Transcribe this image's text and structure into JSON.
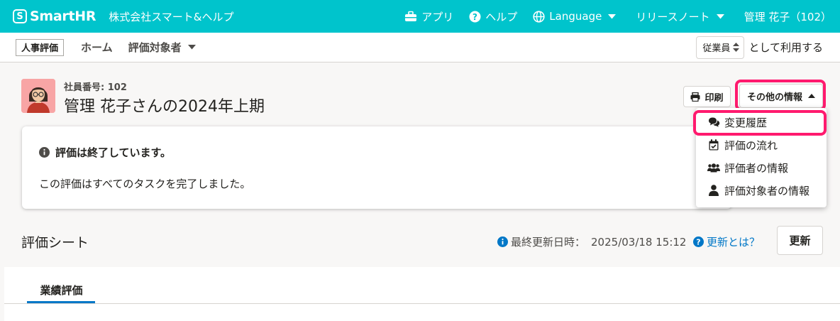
{
  "header": {
    "logo_mark": "S",
    "logo_text": "SmartHR",
    "tenant": "株式会社スマート&ヘルプ",
    "nav": {
      "apps": "アプリ",
      "help": "ヘルプ",
      "language": "Language",
      "release_notes": "リリースノート",
      "user": "管理 花子（102）"
    }
  },
  "subheader": {
    "app_label": "人事評価",
    "home": "ホーム",
    "targets": "評価対象者",
    "role_value": "従業員",
    "role_suffix": "として利用する"
  },
  "profile": {
    "employee_number": "社員番号: 102",
    "title": "管理 花子さんの2024年上期"
  },
  "actions": {
    "print": "印刷",
    "more_info": "その他の情報"
  },
  "dropdown": {
    "items": [
      {
        "label": "変更履歴",
        "icon": "comments-icon"
      },
      {
        "label": "評価の流れ",
        "icon": "calendar-check-icon"
      },
      {
        "label": "評価者の情報",
        "icon": "users-icon"
      },
      {
        "label": "評価対象者の情報",
        "icon": "user-icon"
      }
    ]
  },
  "notice": {
    "title": "評価は終了しています。",
    "body": "この評価はすべてのタスクを完了しました。"
  },
  "sheet": {
    "title": "評価シート",
    "last_updated_label": "最終更新日時：",
    "last_updated_value": "2025/03/18 15:12",
    "help_link": "更新とは？",
    "refresh": "更新"
  },
  "tabs": [
    {
      "label": "業績評価",
      "active": true
    }
  ],
  "colors": {
    "brand": "#00c4cc",
    "link": "#0077c7",
    "highlight": "#ff1a6e",
    "active_tab": "#0077c7"
  }
}
